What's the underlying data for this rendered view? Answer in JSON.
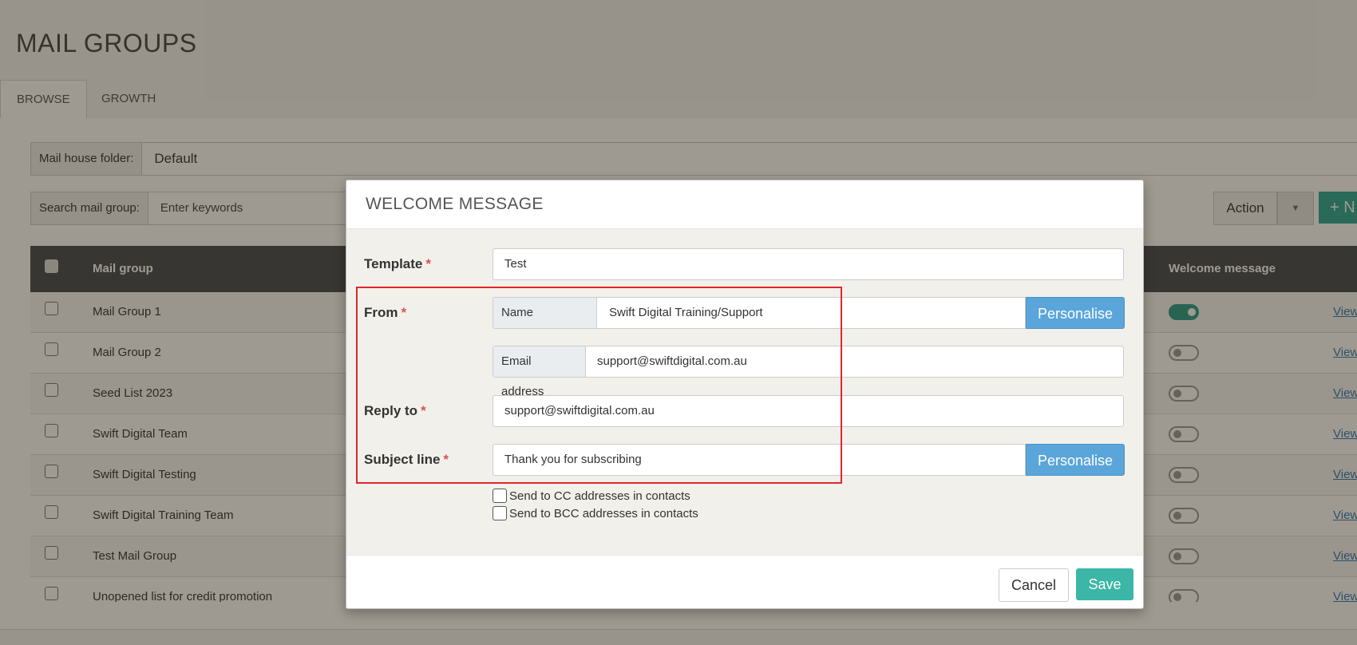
{
  "page": {
    "title": "MAIL GROUPS",
    "tabs": [
      {
        "label": "BROWSE",
        "active": true
      },
      {
        "label": "GROWTH",
        "active": false
      }
    ]
  },
  "filters": {
    "mail_house_folder_label": "Mail house folder:",
    "mail_house_folder_value": "Default",
    "search_label": "Search mail group:",
    "search_placeholder": "Enter keywords"
  },
  "toolbar": {
    "action_label": "Action",
    "new_label": "N"
  },
  "table": {
    "col_mail_group": "Mail group",
    "col_welcome_message": "Welcome message",
    "view_label": "View",
    "rows": [
      {
        "name": "Mail Group 1",
        "welcome_on": true
      },
      {
        "name": "Mail Group 2",
        "welcome_on": false
      },
      {
        "name": "Seed List 2023",
        "welcome_on": false
      },
      {
        "name": "Swift Digital Team",
        "welcome_on": false
      },
      {
        "name": "Swift Digital Testing",
        "welcome_on": false
      },
      {
        "name": "Swift Digital Training Team",
        "welcome_on": false
      },
      {
        "name": "Test Mail Group",
        "welcome_on": false
      },
      {
        "name": "Unopened list for credit promotion",
        "welcome_on": false
      }
    ]
  },
  "modal": {
    "title": "WELCOME MESSAGE",
    "template_label": "Template",
    "template_value": "Test",
    "from_label": "From",
    "name_addon": "Name",
    "name_value": "Swift Digital Training/Support",
    "email_addon": "Email address",
    "email_value": "support@swiftdigital.com.au",
    "reply_to_label": "Reply to",
    "reply_to_value": "support@swiftdigital.com.au",
    "subject_label": "Subject line",
    "subject_value": "Thank you for subscribing",
    "personalise_label": "Personalise",
    "required_mark": "*",
    "send_cc_label": "Send to CC addresses in contacts",
    "send_bcc_label": "Send to BCC addresses in contacts",
    "cancel_label": "Cancel",
    "save_label": "Save"
  },
  "colors": {
    "accent": "#2aa89a",
    "personalise": "#5aa5da",
    "required": "#d9534f",
    "highlight": "#e0262e"
  }
}
